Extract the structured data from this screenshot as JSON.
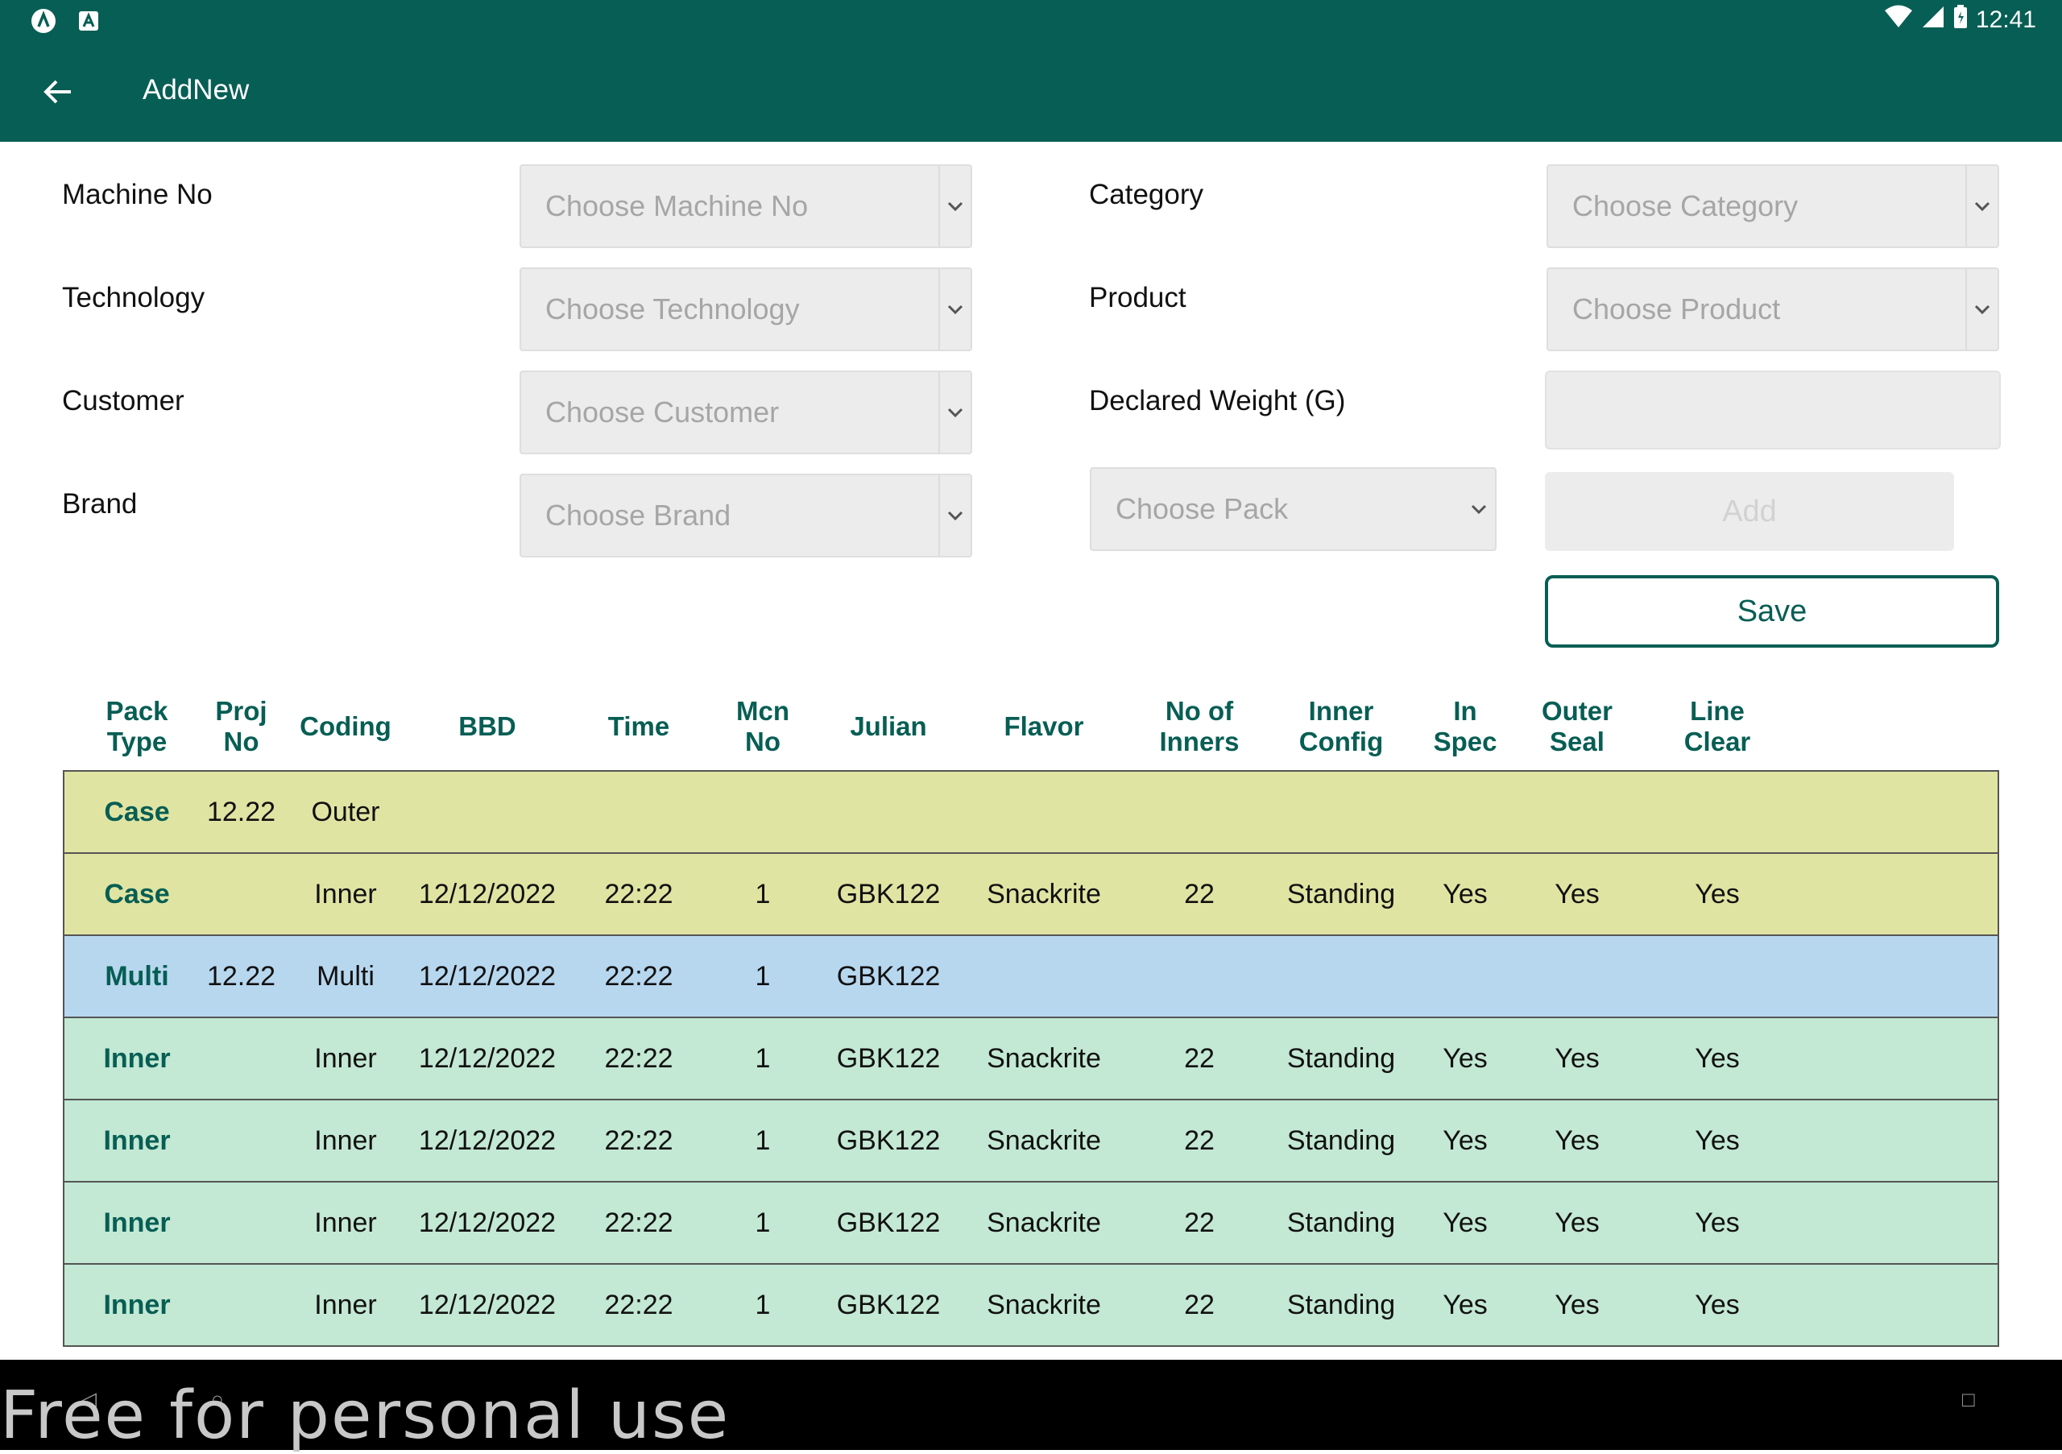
{
  "status_bar": {
    "time": "12:41"
  },
  "app_bar": {
    "title": "AddNew"
  },
  "form": {
    "machine_no": {
      "label": "Machine No",
      "placeholder": "Choose Machine No"
    },
    "technology": {
      "label": "Technology",
      "placeholder": "Choose Technology"
    },
    "customer": {
      "label": "Customer",
      "placeholder": "Choose Customer"
    },
    "brand": {
      "label": "Brand",
      "placeholder": "Choose Brand"
    },
    "category": {
      "label": "Category",
      "placeholder": "Choose Category"
    },
    "product": {
      "label": "Product",
      "placeholder": "Choose Product"
    },
    "declared_weight": {
      "label": "Declared Weight (G)",
      "value": ""
    },
    "pack": {
      "placeholder": "Choose Pack"
    },
    "add_label": "Add",
    "save_label": "Save"
  },
  "table": {
    "headers": [
      "Pack Type",
      "Proj No",
      "Coding",
      "BBD",
      "Time",
      "Mcn No",
      "Julian",
      "Flavor",
      "No of Inners",
      "Inner Config",
      "In Spec",
      "Outer Seal",
      "Line Clear"
    ],
    "rows": [
      {
        "bg": "#e0e4a2",
        "cells": [
          "Case",
          "12.22",
          "Outer",
          "",
          "",
          "",
          "",
          "",
          "",
          "",
          "",
          "",
          ""
        ]
      },
      {
        "bg": "#e0e4a2",
        "cells": [
          "Case",
          "",
          "Inner",
          "12/12/2022",
          "22:22",
          "1",
          "GBK122",
          "Snackrite",
          "22",
          "Standing",
          "Yes",
          "Yes",
          "Yes"
        ]
      },
      {
        "bg": "#b7d7ef",
        "cells": [
          "Multi",
          "12.22",
          "Multi",
          "12/12/2022",
          "22:22",
          "1",
          "GBK122",
          "",
          "",
          "",
          "",
          "",
          ""
        ]
      },
      {
        "bg": "#c3e8d4",
        "cells": [
          "Inner",
          "",
          "Inner",
          "12/12/2022",
          "22:22",
          "1",
          "GBK122",
          "Snackrite",
          "22",
          "Standing",
          "Yes",
          "Yes",
          "Yes"
        ]
      },
      {
        "bg": "#c3e8d4",
        "cells": [
          "Inner",
          "",
          "Inner",
          "12/12/2022",
          "22:22",
          "1",
          "GBK122",
          "Snackrite",
          "22",
          "Standing",
          "Yes",
          "Yes",
          "Yes"
        ]
      },
      {
        "bg": "#c3e8d4",
        "cells": [
          "Inner",
          "",
          "Inner",
          "12/12/2022",
          "22:22",
          "1",
          "GBK122",
          "Snackrite",
          "22",
          "Standing",
          "Yes",
          "Yes",
          "Yes"
        ]
      },
      {
        "bg": "#c3e8d4",
        "cells": [
          "Inner",
          "",
          "Inner",
          "12/12/2022",
          "22:22",
          "1",
          "GBK122",
          "Snackrite",
          "22",
          "Standing",
          "Yes",
          "Yes",
          "Yes"
        ]
      }
    ]
  },
  "watermark": "Free for personal use",
  "colors": {
    "primary": "#075e54"
  }
}
